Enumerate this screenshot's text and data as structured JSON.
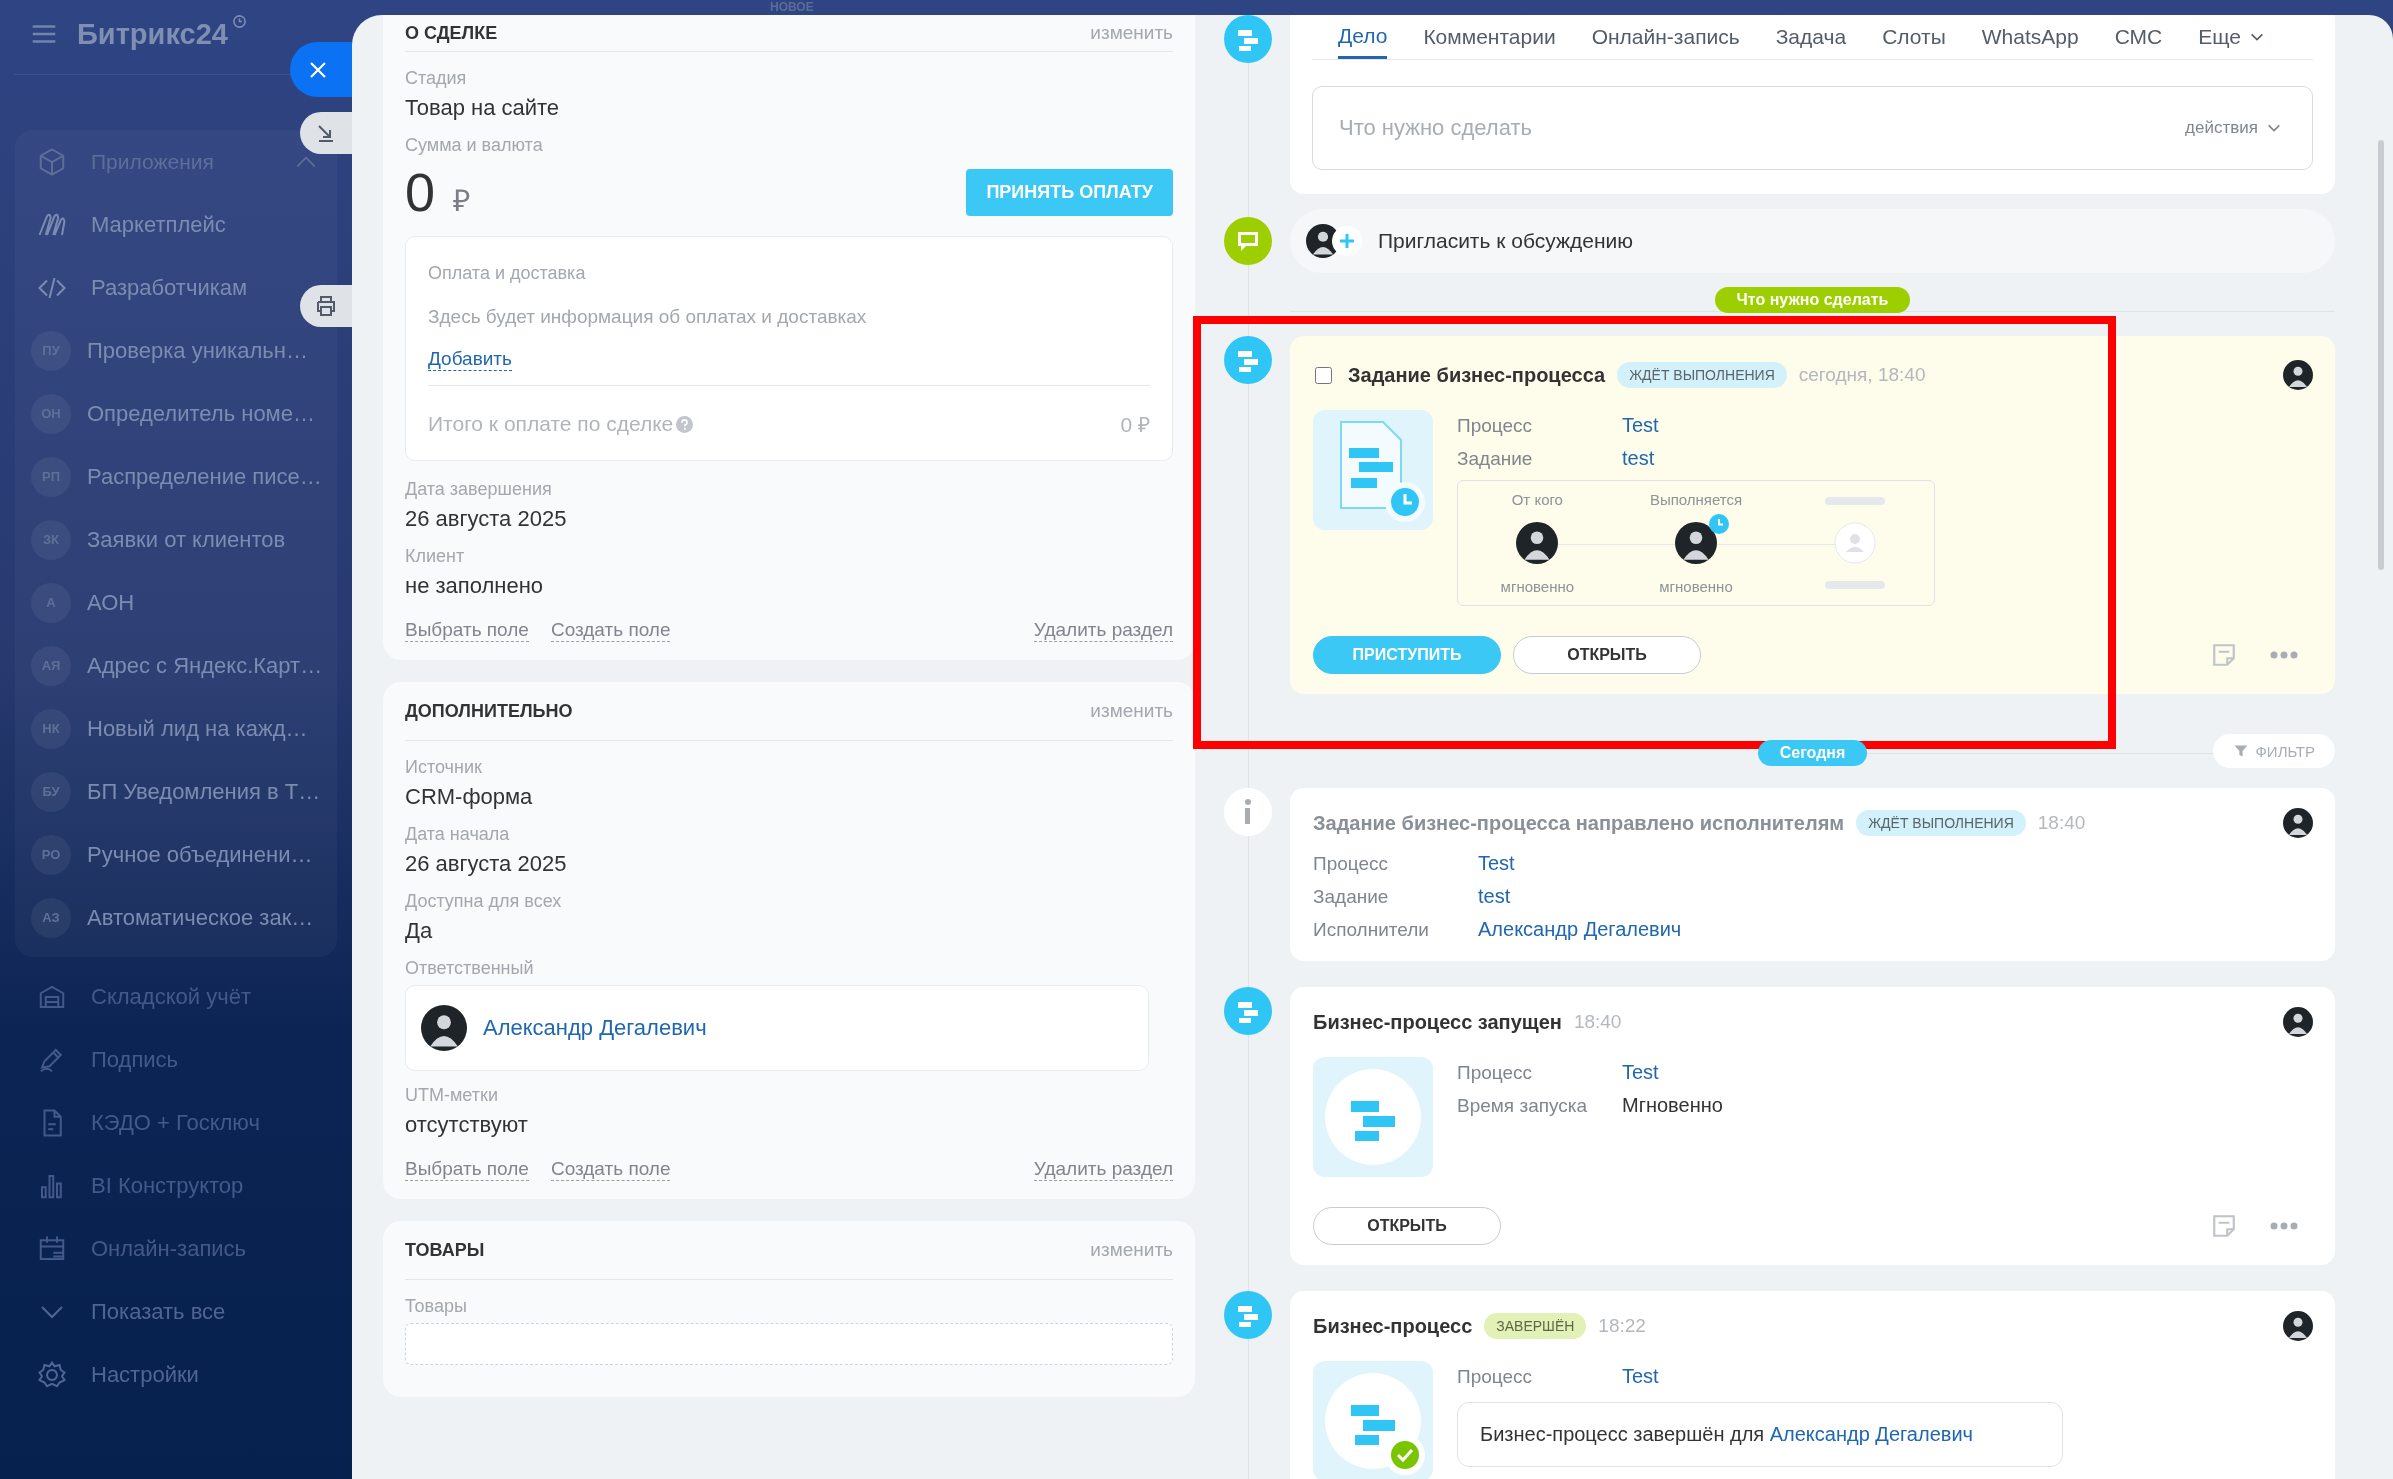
{
  "top_strip": {
    "label": "НОВОЕ"
  },
  "sidebar": {
    "logo": "Битрикс24",
    "group": {
      "title": "Приложения",
      "expanded": true,
      "items": [
        {
          "kind": "icon",
          "label": "Маркетплейс"
        },
        {
          "kind": "icon",
          "label": "Разработчикам"
        },
        {
          "kind": "app",
          "initials": "ПУ",
          "label": "Проверка уникальн…"
        },
        {
          "kind": "app",
          "initials": "ОН",
          "label": "Определитель номе…"
        },
        {
          "kind": "app",
          "initials": "РП",
          "label": "Распределение писе…"
        },
        {
          "kind": "app",
          "initials": "ЗК",
          "label": "Заявки от клиентов"
        },
        {
          "kind": "app",
          "initials": "А",
          "label": "АОН"
        },
        {
          "kind": "app",
          "initials": "АЯ",
          "label": "Адрес с Яндекс.Карт…"
        },
        {
          "kind": "app",
          "initials": "НК",
          "label": "Новый лид на кажд…"
        },
        {
          "kind": "app",
          "initials": "БУ",
          "label": "БП Уведомления в Т…"
        },
        {
          "kind": "app",
          "initials": "РО",
          "label": "Ручное объединени…"
        },
        {
          "kind": "app",
          "initials": "АЗ",
          "label": "Автоматическое зак…"
        }
      ]
    },
    "items": [
      {
        "kind": "tool",
        "label": "Складской учёт"
      },
      {
        "kind": "tool",
        "label": "Подпись"
      },
      {
        "kind": "tool",
        "label": "КЭДО + Госключ"
      },
      {
        "kind": "tool",
        "label": "BI Конструктор"
      },
      {
        "kind": "tool",
        "label": "Онлайн-запись"
      },
      {
        "kind": "footer",
        "label": "Показать все"
      },
      {
        "kind": "footer",
        "label": "Настройки"
      }
    ]
  },
  "deal_sections": [
    {
      "title": "О СДЕЛКЕ",
      "edit": "изменить",
      "fields": [
        {
          "kind": "text",
          "label": "Стадия",
          "value": "Товар на сайте"
        },
        {
          "kind": "amount",
          "label": "Сумма и валюта",
          "value": "0",
          "currency": "₽",
          "button": "ПРИНЯТЬ ОПЛАТУ"
        },
        {
          "kind": "payment",
          "title": "Оплата и доставка",
          "text": "Здесь будет информация об оплатах и доставках",
          "link": "Добавить",
          "total_label": "Итого к оплате по сделке",
          "total": "0 ₽"
        },
        {
          "kind": "text",
          "label": "Дата завершения",
          "value": "26 августа 2025"
        },
        {
          "kind": "text",
          "label": "Клиент",
          "value": "не заполнено"
        }
      ],
      "links": [
        "Выбрать поле",
        "Создать поле"
      ],
      "remove": "Удалить раздел"
    },
    {
      "title": "ДОПОЛНИТЕЛЬНО",
      "edit": "изменить",
      "fields": [
        {
          "kind": "text",
          "label": "Источник",
          "value": "CRM-форма"
        },
        {
          "kind": "text",
          "label": "Дата начала",
          "value": "26 августа 2025"
        },
        {
          "kind": "text",
          "label": "Доступна для всех",
          "value": "Да"
        },
        {
          "kind": "user",
          "label": "Ответственный",
          "value": "Александр Дегалевич"
        },
        {
          "kind": "text",
          "label": "UTM-метки",
          "value": "отсутствуют"
        }
      ],
      "links": [
        "Выбрать поле",
        "Создать поле"
      ],
      "remove": "Удалить раздел"
    },
    {
      "title": "ТОВАРЫ",
      "edit": "изменить",
      "fields": [
        {
          "kind": "box",
          "label": "Товары"
        }
      ]
    }
  ],
  "composer": {
    "tabs": [
      {
        "label": "Дело",
        "selected": true
      },
      {
        "label": "Комментарии",
        "selected": false
      },
      {
        "label": "Онлайн-запись",
        "selected": false
      },
      {
        "label": "Задача",
        "selected": false
      },
      {
        "label": "Слоты",
        "selected": false
      },
      {
        "label": "WhatsApp",
        "selected": false
      },
      {
        "label": "СМС",
        "selected": false
      }
    ],
    "more": "Еще",
    "placeholder": "Что нужно сделать",
    "actions": "действия"
  },
  "invite": {
    "text": "Пригласить к обсуждению"
  },
  "timeline": [
    {
      "kind": "todo",
      "label": "Что нужно сделать"
    },
    {
      "kind": "task",
      "highlighted": true,
      "checked": false,
      "title": "Задание бизнес-процесса",
      "badge": {
        "text": "ЖДЁТ ВЫПОЛНЕНИЯ",
        "color": "#d3f1fb"
      },
      "time": "сегодня, 18:40",
      "props": [
        {
          "label": "Процесс",
          "value": "Test",
          "link": true
        },
        {
          "label": "Задание",
          "value": "test",
          "link": true
        }
      ],
      "flow": [
        {
          "kind": "user",
          "label": "От кого",
          "caption": "мгновенно",
          "pending": false
        },
        {
          "kind": "user",
          "label": "Выполняется",
          "caption": "мгновенно",
          "pending": true
        },
        {
          "kind": "empty"
        }
      ],
      "buttons": [
        {
          "label": "ПРИСТУПИТЬ",
          "primary": true
        },
        {
          "label": "ОТКРЫТЬ",
          "primary": false
        }
      ]
    },
    {
      "kind": "today",
      "label": "Сегодня",
      "filter": "ФИЛЬТР"
    },
    {
      "kind": "info",
      "highlighted": false,
      "title": "Задание бизнес-процесса направлено исполнителям",
      "badge": {
        "text": "ЖДЁТ ВЫПОЛНЕНИЯ",
        "color": "#d3f1fb"
      },
      "time": "18:40",
      "props": [
        {
          "label": "Процесс",
          "value": "Test",
          "link": true
        },
        {
          "label": "Задание",
          "value": "test",
          "link": true
        },
        {
          "label": "Исполнители",
          "value": "Александр Дегалевич",
          "link": true
        }
      ]
    },
    {
      "kind": "started",
      "highlighted": false,
      "title": "Бизнес-процесс запущен",
      "time": "18:40",
      "props": [
        {
          "label": "Процесс",
          "value": "Test",
          "link": true
        },
        {
          "label": "Время запуска",
          "value": "Мгновенно",
          "link": false
        }
      ],
      "buttons": [
        {
          "label": "ОТКРЫТЬ",
          "primary": false
        }
      ]
    },
    {
      "kind": "finished",
      "highlighted": false,
      "title": "Бизнес-процесс",
      "badge": {
        "text": "ЗАВЕРШЁН",
        "color": "#e2f1b5"
      },
      "time": "18:22",
      "props": [
        {
          "label": "Процесс",
          "value": "Test",
          "link": true
        }
      ],
      "note": {
        "text": "Бизнес-процесс завершён для",
        "link": "Александр Дегалевич"
      }
    }
  ]
}
